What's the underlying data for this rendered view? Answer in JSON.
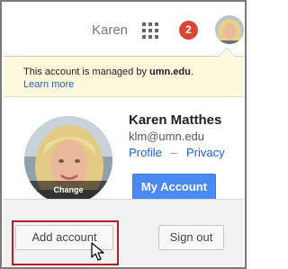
{
  "topbar": {
    "user_name": "Karen",
    "apps_icon": "apps-grid-icon",
    "notification_count": "2",
    "avatar_icon": "user-avatar"
  },
  "banner": {
    "text_prefix": "This account is managed by ",
    "domain": "umn.edu",
    "text_suffix": ".",
    "learn_more": "Learn more"
  },
  "profile": {
    "photo_change_label": "Change",
    "full_name": "Karen Matthes",
    "email": "klm@umn.edu",
    "profile_link": "Profile",
    "separator": "–",
    "privacy_link": "Privacy",
    "my_account_button": "My Account"
  },
  "footer": {
    "add_account_button": "Add account",
    "sign_out_button": "Sign out"
  },
  "colors": {
    "accent_blue": "#4a8af4",
    "link_blue": "#1a62d4",
    "badge_red": "#db4437",
    "banner_yellow": "#fef8dc",
    "highlight_red": "#b0202a"
  }
}
